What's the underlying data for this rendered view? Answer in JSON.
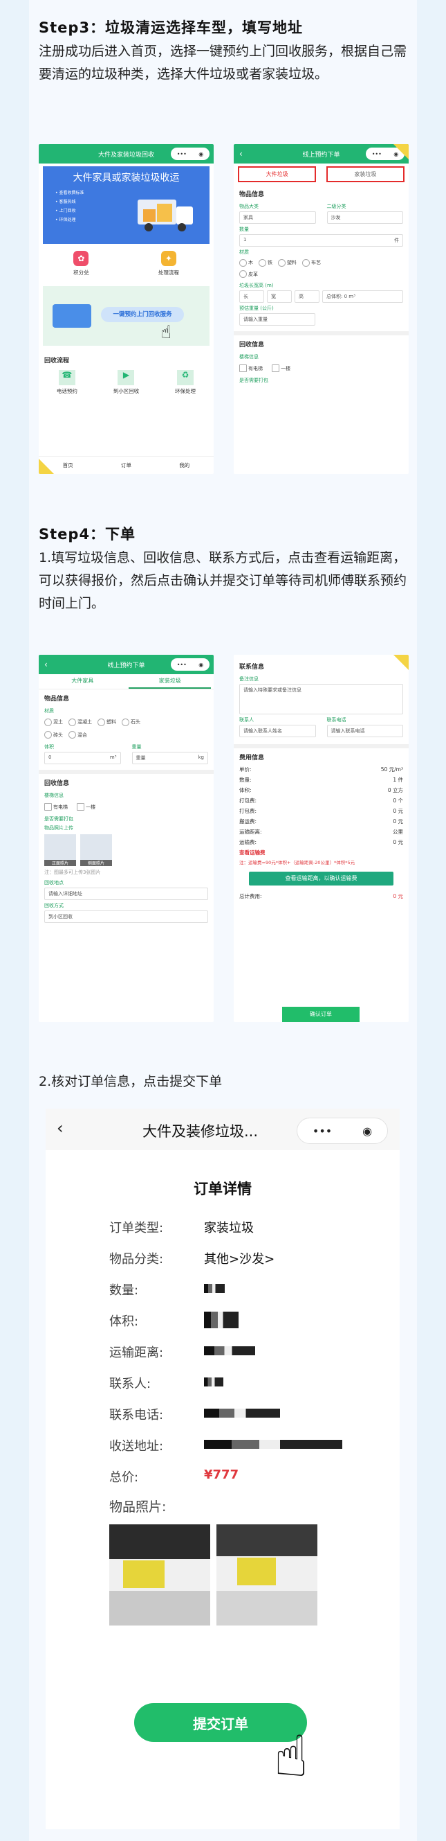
{
  "step3": {
    "title": "Step3：垃圾清运选择车型，填写地址",
    "desc": "注册成功后进入首页，选择一键预约上门回收服务，根据自己需要清运的垃圾种类，选择大件垃圾或者家装垃圾。"
  },
  "step4": {
    "title": "Step4：下单",
    "desc": "1.填写垃圾信息、回收信息、联系方式后，点击查看运输距离，可以获得报价，然后点击确认并提交订单等待司机师傅联系预约时间上门。"
  },
  "step5": {
    "desc": "2.核对订单信息，点击提交下单"
  },
  "shot1": {
    "bar_title": "大件及家装垃圾回收",
    "banner_title": "大件家具或家装垃圾收运",
    "banner_items": [
      "• 查看收费标准",
      "• 客服热线",
      "• 上门回收",
      "• 环保处理"
    ],
    "icon1": "积分兑",
    "icon2": "处理流程",
    "cta": "一键预约上门回收服务",
    "flow_title": "回收流程",
    "flow_items": [
      "电话预约",
      "到小区回收",
      "环保处理"
    ],
    "tabbar": [
      "首页",
      "订单",
      "我的"
    ]
  },
  "shot2": {
    "bar_title": "线上预约下单",
    "tab_active": "大件垃圾",
    "tab_other": "家装垃圾",
    "sec": "物品信息",
    "cat_lbl": "物品大类",
    "cat_val": "家具",
    "sub_lbl": "二级分类",
    "sub_val": "沙发",
    "qty_lbl": "数量",
    "qty_val": "1",
    "qty_unit": "件",
    "mat_lbl": "材质",
    "materials": [
      "木",
      "铁",
      "塑料",
      "布艺",
      "皮革"
    ],
    "size_lbl": "垃圾长宽高 (m)",
    "size_ph": [
      "长",
      "宽",
      "高"
    ],
    "size_note": "总体积: 0 m³",
    "weight_lbl": "预估重量 (公斤)",
    "weight_ph": "请输入重量",
    "rec_sec": "回收信息",
    "elev_lbl": "楼梯信息",
    "elev_opts": [
      "有电梯",
      "一楼"
    ],
    "carry_lbl": "是否需要打包"
  },
  "shot3": {
    "bar_title": "线上预约下单",
    "tab_big": "大件家具",
    "tab_home": "家装垃圾",
    "sec": "物品信息",
    "mat_lbl": "材质",
    "materials": [
      "泥土",
      "混凝土",
      "塑料",
      "石头",
      "砖头",
      "混合"
    ],
    "vol_lbl": "体积",
    "vol_val": "0",
    "vol_unit": "m³",
    "wt_lbl": "重量",
    "wt_val": "重量",
    "wt_unit": "kg",
    "rec_sec": "回收信息",
    "elev_lbl": "楼梯信息",
    "elev_opts": [
      "有电梯",
      "一楼"
    ],
    "pack_lbl": "是否需要打包",
    "photo_lbl": "物品照片上传",
    "photo_tags": [
      "正面照片",
      "侧面照片"
    ],
    "photo_note": "注：图最多可上传3张图片",
    "addr_lbl": "回收地点",
    "addr_ph": "请输入详细地址",
    "method_lbl": "回收方式",
    "method_val": "到小区回收"
  },
  "shot4": {
    "sec1": "联系信息",
    "note_lbl": "备注信息",
    "note_ph": "请输入特殊要求或备注信息",
    "contact_lbl": "联系人",
    "contact_ph": "请输入联系人姓名",
    "phone_lbl": "联系电话",
    "phone_ph": "请输入联系电话",
    "fee_sec": "费用信息",
    "fees": [
      {
        "k": "单价:",
        "v": "50 元/m³"
      },
      {
        "k": "数量:",
        "v": "1 件"
      },
      {
        "k": "体积:",
        "v": "0 立方"
      },
      {
        "k": "打包费:",
        "v": "0 个"
      },
      {
        "k": "打包费:",
        "v": "0 元"
      },
      {
        "k": "搬运费:",
        "v": "0 元"
      },
      {
        "k": "运输距离:",
        "v": "公里"
      },
      {
        "k": "运输费:",
        "v": "0 元"
      }
    ],
    "red_line": "查看运输费",
    "red_note": "注：运输费=90元*体积+（运输距离-20公里）*体积*5元",
    "check_btn": "查看运输距离，以确认运输费",
    "total_lbl": "总计费用:",
    "total_val": "0 元",
    "confirm_btn": "确认订单"
  },
  "order": {
    "nav_title": "大件及装修垃圾...",
    "heading": "订单详情",
    "rows": [
      {
        "k": "订单类型:",
        "v": "家装垃圾"
      },
      {
        "k": "物品分类:",
        "v": "其他>沙发>"
      },
      {
        "k": "数量:",
        "v": ""
      },
      {
        "k": "体积:",
        "v": ""
      },
      {
        "k": "运输距离:",
        "v": ""
      },
      {
        "k": "联系人:",
        "v": ""
      },
      {
        "k": "联系电话:",
        "v": ""
      },
      {
        "k": "收送地址:",
        "v": ""
      },
      {
        "k": "总价:",
        "v": "¥777"
      }
    ],
    "photos_lbl": "物品照片:",
    "submit": "提交订单",
    "price_color": "#e0383e"
  },
  "colors": {
    "green": "#22b573",
    "submit_green": "#21bd6a",
    "bg": "#e9f3fb",
    "red": "#e0383e"
  }
}
